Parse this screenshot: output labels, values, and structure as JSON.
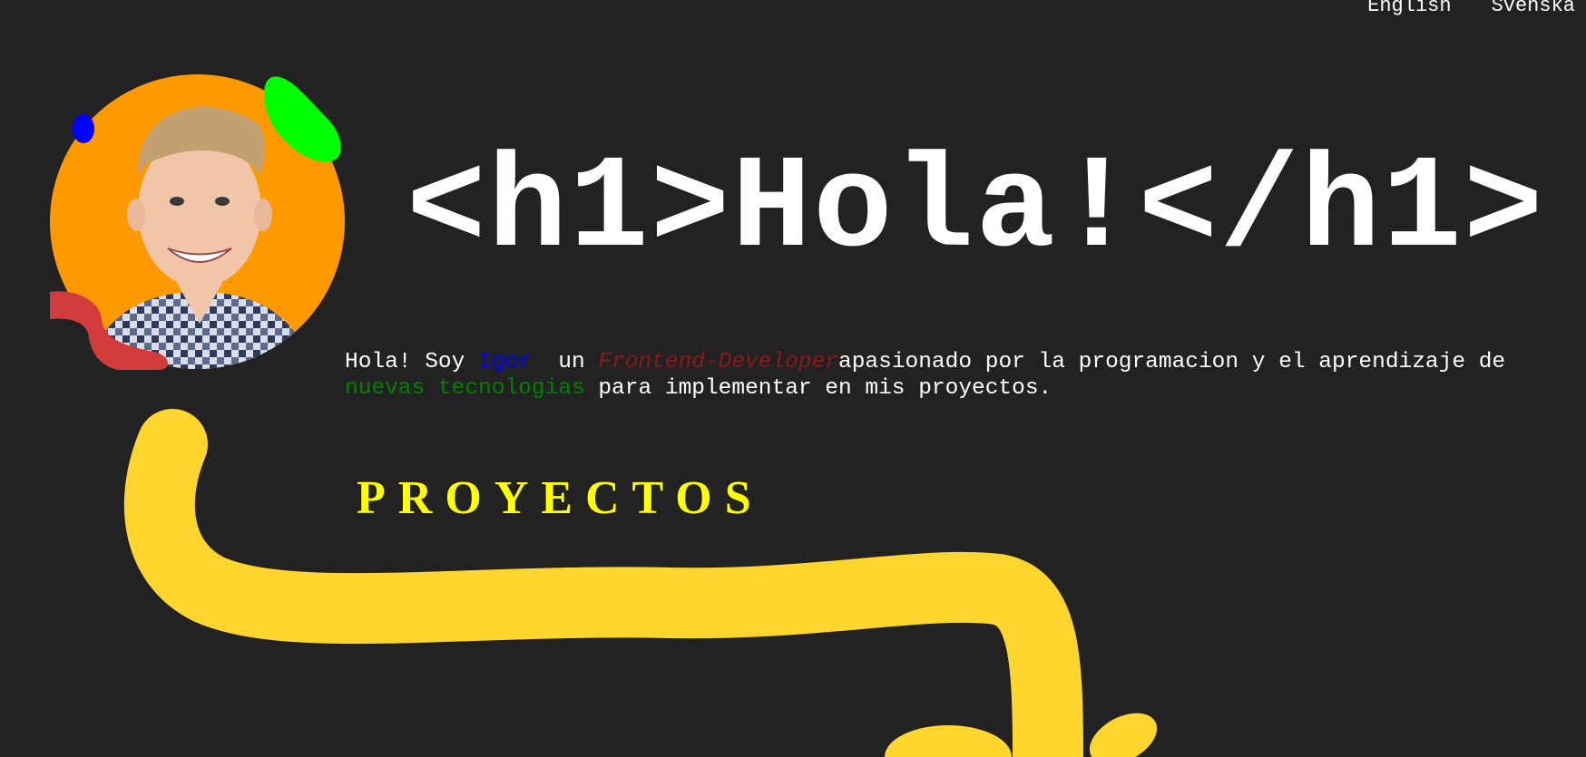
{
  "nav": {
    "languages": [
      "English",
      "Svenska"
    ]
  },
  "hero": {
    "title": "<h1>Hola!</h1>",
    "avatar_icon": "portrait-photo"
  },
  "intro": {
    "part1": "Hola! Soy ",
    "name": "Igor",
    "part2": "  un ",
    "role": "Frontend-Developer",
    "part3": "apasionado por la programacion y el aprendizaje de ",
    "tech": "nuevas tecnologias",
    "part4": " para implementar en mis proyectos."
  },
  "projects": {
    "title": "PROYECTOS"
  },
  "colors": {
    "background": "#222222",
    "accent_yellow": "#ffff00",
    "blob_yellow": "#ffd52e",
    "avatar_bg": "#ff9900",
    "blob_green": "#00ff00",
    "blob_blue": "#0000ff",
    "blob_red": "#d23c3c"
  }
}
